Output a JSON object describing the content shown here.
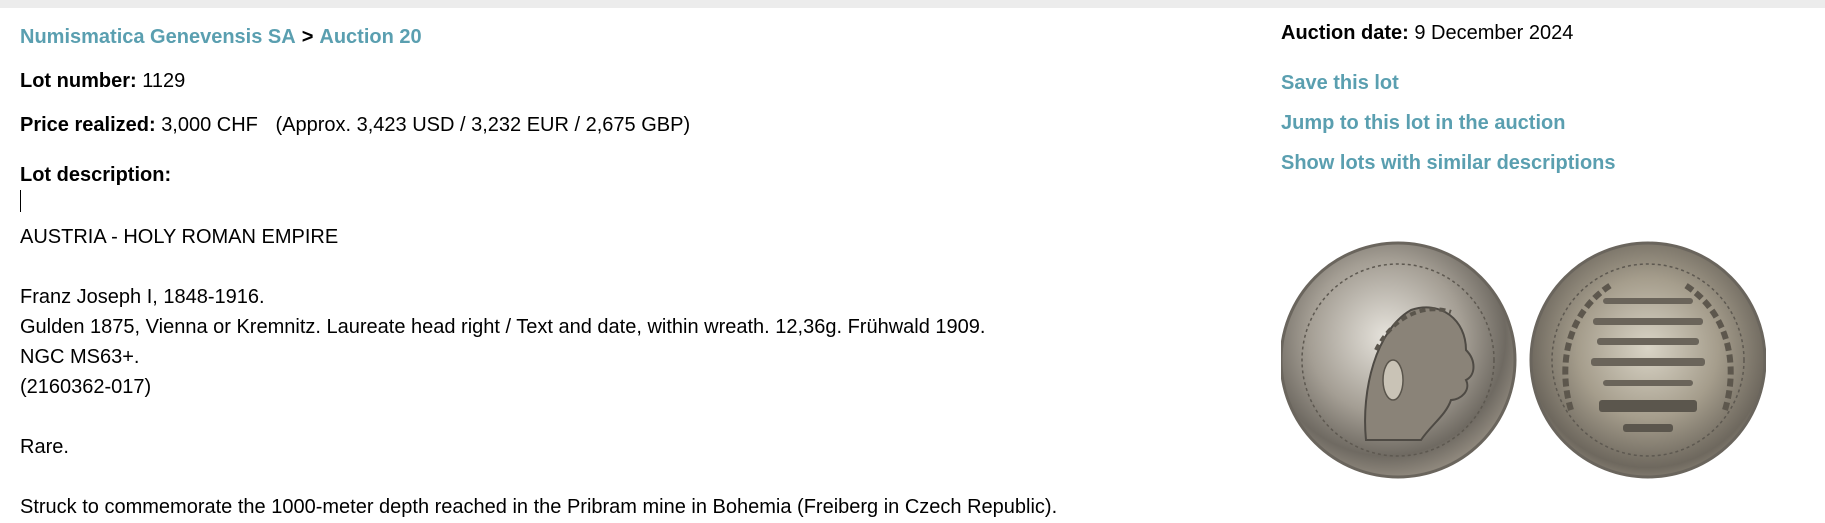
{
  "breadcrumb": {
    "auction_house": "Numismatica Genevensis SA",
    "separator": ">",
    "auction": "Auction 20"
  },
  "lot": {
    "number_label": "Lot number:",
    "number": "1129",
    "price_label": "Price realized:",
    "price": "3,000 CHF",
    "price_approx": "(Approx. 3,423 USD / 3,232 EUR / 2,675 GBP)",
    "description_label": "Lot description:",
    "description_lines": [
      "AUSTRIA - HOLY ROMAN EMPIRE",
      "",
      "Franz Joseph I, 1848-1916.",
      "Gulden 1875, Vienna or Kremnitz. Laureate head right / Text and date, within wreath. 12,36g. Frühwald 1909.",
      "NGC MS63+.",
      "(2160362-017)",
      "",
      "Rare.",
      "",
      "Struck to commemorate the 1000-meter depth reached in the Pribram mine in Bohemia (Freiberg in Czech Republic)."
    ]
  },
  "sidebar": {
    "auction_date_label": "Auction date:",
    "auction_date": "9 December 2024",
    "links": [
      "Save this lot",
      "Jump to this lot in the auction",
      "Show lots with similar descriptions"
    ]
  },
  "colors": {
    "link": "#5a9fb0",
    "background": "#ececec",
    "panel": "#ffffff"
  },
  "image": {
    "subject": "coin-obverse-reverse-photo"
  }
}
